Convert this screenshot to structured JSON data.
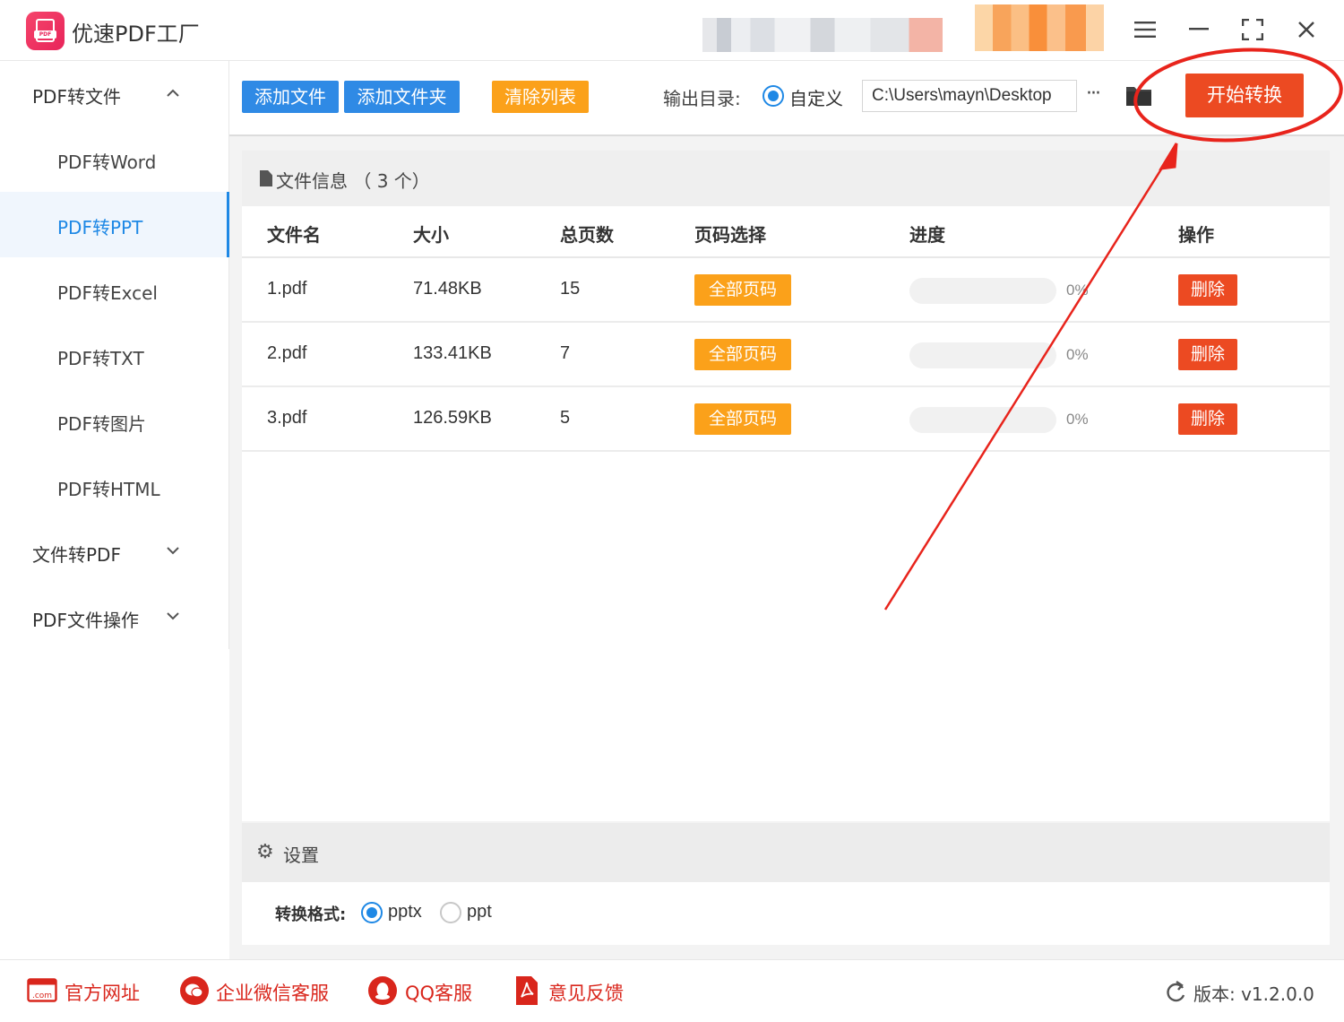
{
  "app": {
    "title": "优速PDF工厂",
    "logo_text": "PDF"
  },
  "sidebar": {
    "groups": [
      {
        "label": "PDF转文件",
        "expanded": true,
        "items": [
          "PDF转Word",
          "PDF转PPT",
          "PDF转Excel",
          "PDF转TXT",
          "PDF转图片",
          "PDF转HTML"
        ]
      },
      {
        "label": "文件转PDF",
        "expanded": false
      },
      {
        "label": "PDF文件操作",
        "expanded": false
      }
    ],
    "active_item": "PDF转PPT"
  },
  "toolbar": {
    "add_file": "添加文件",
    "add_folder": "添加文件夹",
    "clear_list": "清除列表",
    "output_label": "输出目录:",
    "output_option": "自定义",
    "output_path": "C:\\Users\\mayn\\Desktop",
    "more": "···",
    "start": "开始转换"
  },
  "file_panel": {
    "title": "文件信息 （ 3 个）",
    "columns": [
      "文件名",
      "大小",
      "总页数",
      "页码选择",
      "进度",
      "操作"
    ],
    "rows": [
      {
        "name": "1.pdf",
        "size": "71.48KB",
        "pages": "15",
        "page_select": "全部页码",
        "progress": 0,
        "progress_text": "0%",
        "action": "删除"
      },
      {
        "name": "2.pdf",
        "size": "133.41KB",
        "pages": "7",
        "page_select": "全部页码",
        "progress": 0,
        "progress_text": "0%",
        "action": "删除"
      },
      {
        "name": "3.pdf",
        "size": "126.59KB",
        "pages": "5",
        "page_select": "全部页码",
        "progress": 0,
        "progress_text": "0%",
        "action": "删除"
      }
    ]
  },
  "settings": {
    "title": "设置",
    "format_label": "转换格式:",
    "options": [
      "pptx",
      "ppt"
    ],
    "selected": "pptx"
  },
  "footer": {
    "website": "官方网址",
    "wechat": "企业微信客服",
    "qq": "QQ客服",
    "feedback": "意见反馈",
    "version": "版本: v1.2.0.0"
  },
  "icons": [
    "app-logo-icon",
    "menu-icon",
    "minimize-icon",
    "fullscreen-icon",
    "close-icon",
    "chevron-up-icon",
    "chevron-down-icon",
    "folder-icon",
    "file-icon",
    "gear-icon",
    "com-icon",
    "wechat-icon",
    "qq-icon",
    "pdf-feedback-icon",
    "refresh-icon"
  ],
  "colors": {
    "accent_blue": "#2f8ae5",
    "orange": "#fba11a",
    "red": "#ec4a22",
    "link_red": "#d9261c",
    "annotation_red": "#e8241c"
  }
}
